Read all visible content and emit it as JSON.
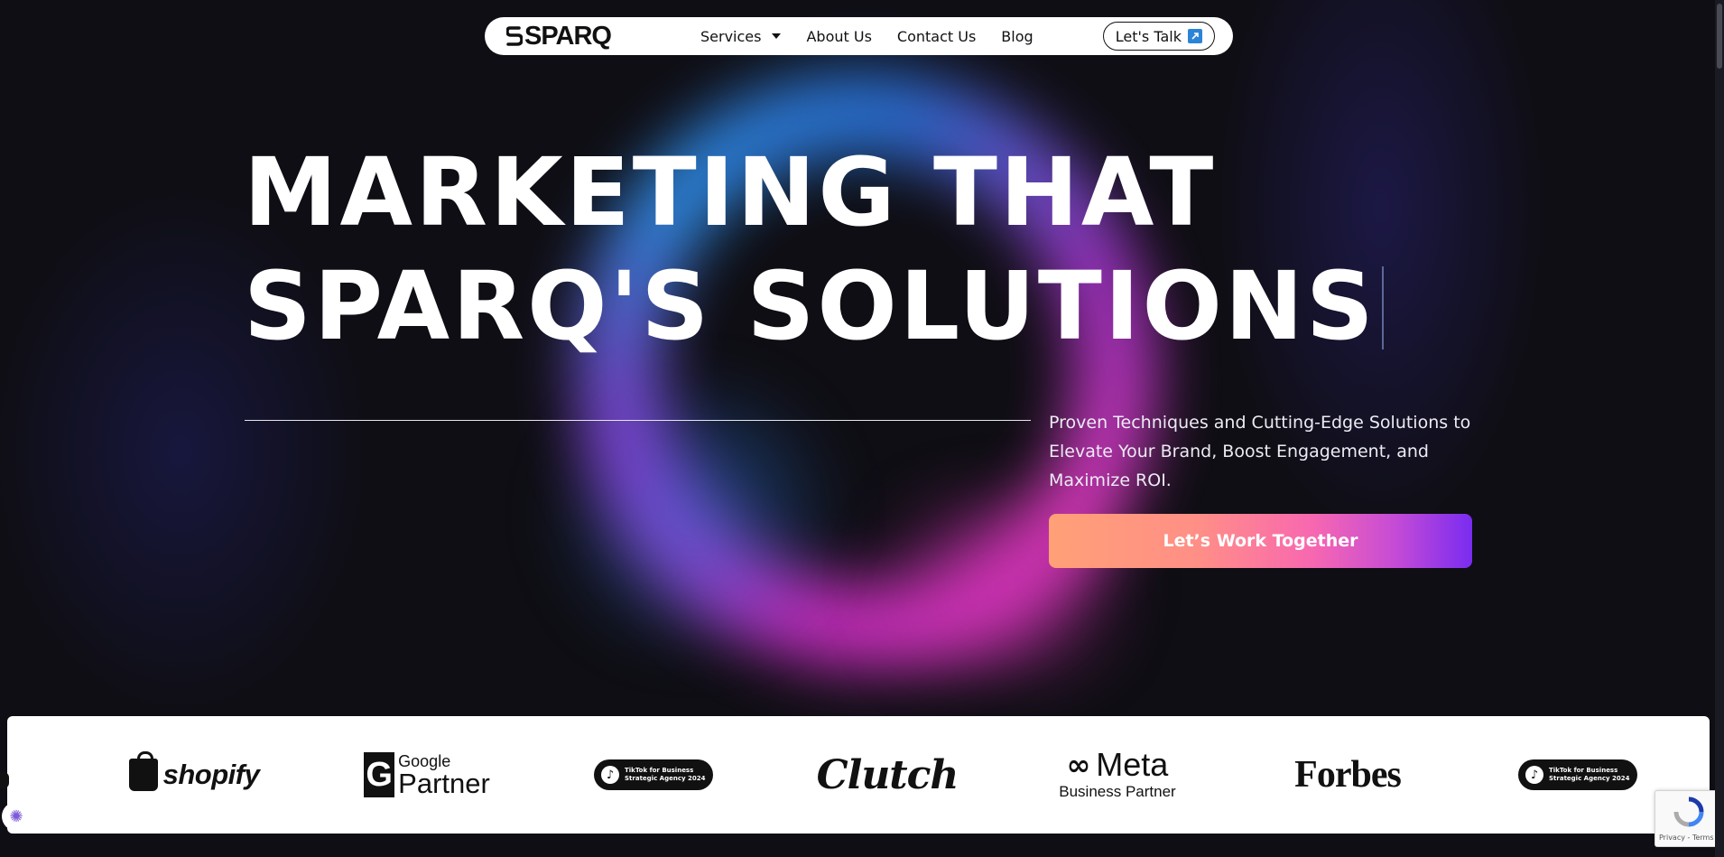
{
  "nav": {
    "logo_text": "SPARQ",
    "links": [
      {
        "label": "Services",
        "has_dropdown": true
      },
      {
        "label": "About Us"
      },
      {
        "label": "Contact Us"
      },
      {
        "label": "Blog"
      }
    ],
    "cta_label": "Let's Talk",
    "cta_icon": "external-arrow-icon"
  },
  "hero": {
    "headline_line1": "MARKETING THAT",
    "headline_line2": "SPARQ'S SOLUTIONS",
    "subtext": "Proven Techniques and Cutting-Edge Solutions to Elevate Your Brand, Boost Engagement, and Maximize ROI.",
    "cta_label": "Let’s Work Together",
    "cta_gradient": [
      "#ffa077",
      "#f868b0",
      "#7a2cf0"
    ]
  },
  "partners": {
    "shopify": "shopify",
    "google_top": "Google",
    "google_bottom": "Partner",
    "tiktok_line1": "TikTok for Business",
    "tiktok_line2": "Strategic Agency 2024",
    "clutch": "Clutch",
    "meta_top": "Meta",
    "meta_bottom": "Business Partner",
    "forbes": "Forbes"
  },
  "recaptcha": {
    "footer": "Privacy - Terms"
  },
  "colors": {
    "background": "#0f0e14",
    "accent_blue": "#2b84d8",
    "accent_pink": "#d12fc7"
  }
}
